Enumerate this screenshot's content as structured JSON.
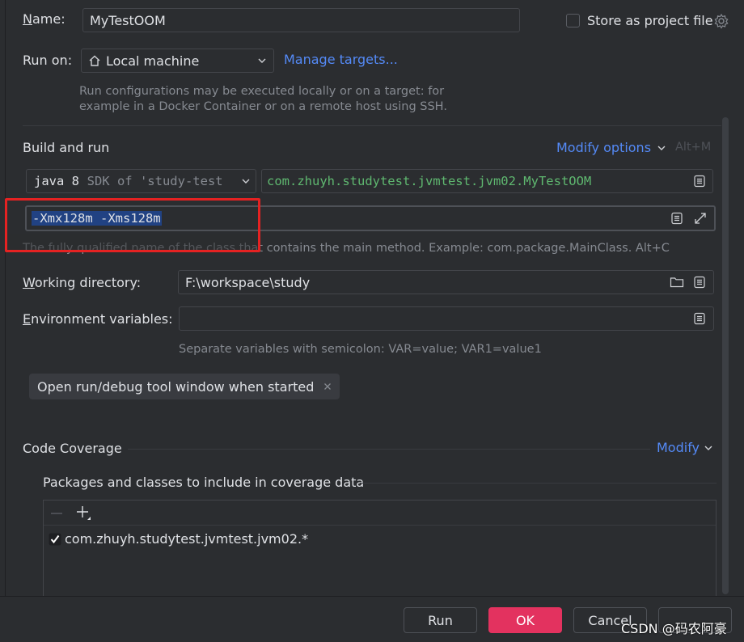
{
  "form": {
    "name_label_rest": "ame:",
    "name_label_u": "N",
    "name_value": "MyTestOOM",
    "store_label": "Store as project file",
    "run_on_label": "Run on:",
    "run_on_value": "Local machine",
    "manage_targets": "Manage targets...",
    "run_hint_1": "Run configurations may be executed locally or on a target: for",
    "run_hint_2": "example in a Docker Container or on a remote host using SSH."
  },
  "build": {
    "section_title": "Build and run",
    "modify_options": "Modify options",
    "modify_shortcut": "Alt+M",
    "sdk_java": "java 8",
    "sdk_rest": "SDK of 'study-test",
    "main_class": "com.zhuyh.studytest.jvmtest.jvm02.MyTestOOM",
    "vm_options": "-Xmx128m -Xms128m",
    "main_class_hint": "The fully qualified name of the class that contains the main method. Example: com.package.MainClass. Alt+C",
    "workdir_u": "W",
    "workdir_label_rest": "orking directory:",
    "workdir_value": "F:\\workspace\\study",
    "env_u": "E",
    "env_label_rest": "nvironment variables:",
    "env_hint": "Separate variables with semicolon: VAR=value; VAR1=value1",
    "chip_label": "Open run/debug tool window when started"
  },
  "coverage": {
    "title": "Code Coverage",
    "modify": "Modify",
    "packages_label": "Packages and classes to include in coverage data",
    "item": "com.zhuyh.studytest.jvmtest.jvm02.*"
  },
  "footer": {
    "run": "Run",
    "ok": "OK",
    "cancel": "Cancel",
    "watermark": "CSDN @码农阿豪"
  },
  "colors": {
    "accent": "#548af7",
    "ok_button": "#e3325f",
    "highlight_box": "#e52222",
    "mono_green": "#5fb870"
  }
}
